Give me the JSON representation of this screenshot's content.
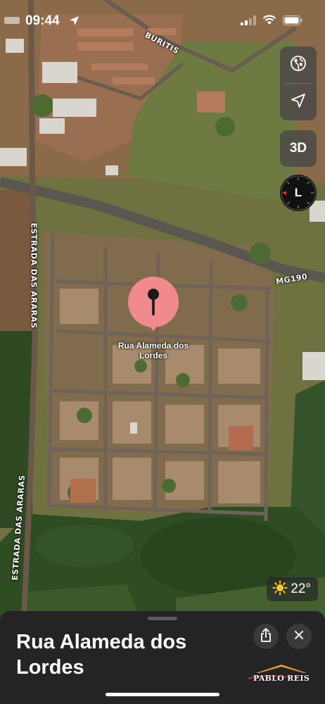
{
  "status_bar": {
    "time": "09:44",
    "icons": [
      "location-arrow-icon",
      "cellular-signal-icon",
      "wifi-icon",
      "battery-icon"
    ]
  },
  "map": {
    "type": "satellite",
    "street_labels": {
      "buritis": "BURITIS",
      "mg190": "MG190",
      "estrada_top": "ESTRADA DAS ARARAS",
      "estrada_bottom": "ESTRADA DAS ARARAS"
    },
    "pin": {
      "label": "Rua Alameda dos Lordes",
      "color": "#f08a8d"
    }
  },
  "controls": {
    "map_mode_icon": "globe-icon",
    "locate_icon": "location-arrow-icon",
    "three_d_label": "3D",
    "compass_letter": "L",
    "compass_accent": "#e0302a"
  },
  "weather": {
    "icon": "sun-icon",
    "temperature": "22°"
  },
  "sheet": {
    "title": "Rua Alameda dos Lordes",
    "share_icon": "share-icon",
    "close_icon": "close-icon"
  },
  "watermark": {
    "text": "PABLO REIS"
  }
}
